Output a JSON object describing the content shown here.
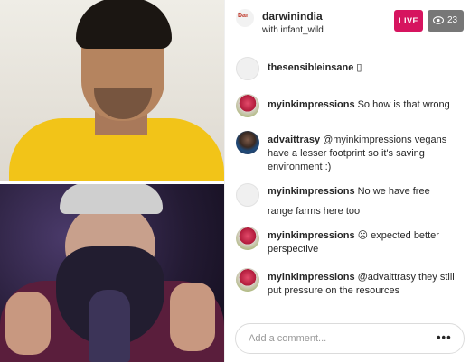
{
  "host": {
    "avatar_text": "Dar",
    "name": "darwinindia",
    "subtitle": "with infant_wild"
  },
  "live_badge": "LIVE",
  "viewers": {
    "icon": "eye-icon",
    "count": "23"
  },
  "comments": [
    {
      "user": "thesensibleinsane",
      "text": "▯",
      "avatar": "blank"
    },
    {
      "user": "myinkimpressions",
      "text": "So how is that wrong",
      "avatar": "art"
    },
    {
      "user": "advaittrasy",
      "text": "@myinkimpressions vegans have a lesser footprint so it's saving environment :)",
      "avatar": "person"
    },
    {
      "user": "myinkimpressions",
      "text": "No we have free range farms here too",
      "avatar": "blank"
    },
    {
      "user": "myinkimpressions",
      "text": "☹ expected better perspective",
      "avatar": "art"
    },
    {
      "user": "myinkimpressions",
      "text": "@advaittrasy they still put pressure on the resources",
      "avatar": "art"
    }
  ],
  "compose": {
    "placeholder": "Add a comment...",
    "more_label": "•••"
  },
  "colors": {
    "live": "#d6145f",
    "viewer_badge": "#777777",
    "border": "#dbdbdb"
  }
}
